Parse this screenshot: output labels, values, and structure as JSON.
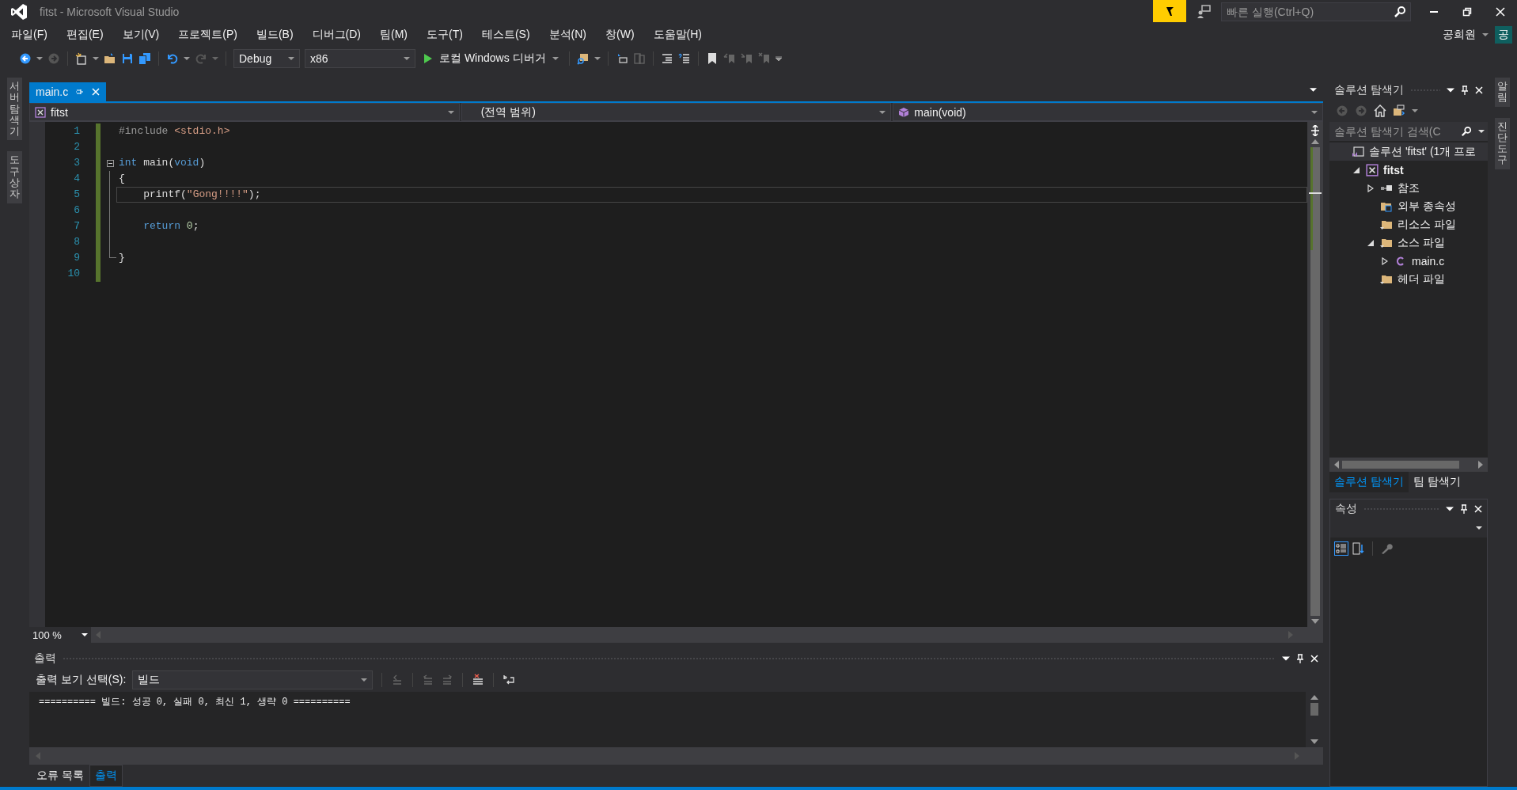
{
  "window": {
    "title": "fitst - Microsoft Visual Studio"
  },
  "title_bar": {
    "quick_launch_placeholder": "빠른 실행(Ctrl+Q)",
    "user": "공희원",
    "avatar": "공"
  },
  "menu": [
    "파일(F)",
    "편집(E)",
    "보기(V)",
    "프로젝트(P)",
    "빌드(B)",
    "디버그(D)",
    "팀(M)",
    "도구(T)",
    "테스트(S)",
    "분석(N)",
    "창(W)",
    "도움말(H)"
  ],
  "toolbar": {
    "configuration": "Debug",
    "platform": "x86",
    "run_label": "로컬 Windows 디버거"
  },
  "left_strip": [
    "서버 탐색기",
    "도구 상자"
  ],
  "right_strip": [
    "알림",
    "진단 도구"
  ],
  "document_tabs": [
    {
      "label": "main.c",
      "selected": true
    }
  ],
  "navigation_bar": {
    "project": "fitst",
    "scope": "(전역 범위)",
    "member": "main(void)"
  },
  "editor": {
    "zoom": "100 %",
    "lines": [
      {
        "number": "1",
        "collapsible": false,
        "in_block": false,
        "current": false,
        "tokens": [
          {
            "text": "#include ",
            "kind": "preprocessor"
          },
          {
            "text": "<stdio.h>",
            "kind": "string"
          }
        ]
      },
      {
        "number": "2",
        "collapsible": false,
        "in_block": false,
        "current": false
      },
      {
        "number": "3",
        "collapsible": true,
        "in_block": false,
        "current": false,
        "tokens": [
          {
            "text": "int",
            "kind": "keyword"
          },
          {
            "text": " main(",
            "kind": "plain"
          },
          {
            "text": "void",
            "kind": "keyword"
          },
          {
            "text": ")",
            "kind": "plain"
          }
        ]
      },
      {
        "number": "4",
        "collapsible": false,
        "in_block": true,
        "current": false,
        "tokens": [
          {
            "text": "{",
            "kind": "plain"
          }
        ]
      },
      {
        "number": "5",
        "collapsible": false,
        "in_block": true,
        "current": true,
        "tokens": [
          {
            "text": "    printf(",
            "kind": "plain"
          },
          {
            "text": "\"Gong!!!!\"",
            "kind": "string"
          },
          {
            "text": ");",
            "kind": "plain"
          }
        ]
      },
      {
        "number": "6",
        "collapsible": false,
        "in_block": true,
        "current": false
      },
      {
        "number": "7",
        "collapsible": false,
        "in_block": true,
        "current": false,
        "tokens": [
          {
            "text": "    return",
            "kind": "keyword"
          },
          {
            "text": " 0",
            "kind": "number"
          },
          {
            "text": ";",
            "kind": "plain"
          }
        ]
      },
      {
        "number": "8",
        "collapsible": false,
        "in_block": true,
        "current": false
      },
      {
        "number": "9",
        "collapsible": false,
        "in_block": true,
        "current": false,
        "tokens": [
          {
            "text": "}",
            "kind": "plain"
          }
        ]
      },
      {
        "number": "10",
        "collapsible": false,
        "in_block": false,
        "current": false
      }
    ]
  },
  "output": {
    "title": "출력",
    "source_label": "출력 보기 선택(S):",
    "source": "빌드",
    "text": "========== 빌드: 성공 0, 실패 0, 최신 1, 생략 0 =========="
  },
  "bottom_tabs": [
    {
      "label": "오류 목록",
      "selected": false
    },
    {
      "label": "출력",
      "selected": true
    }
  ],
  "solution_explorer": {
    "title": "솔루션 탐색기",
    "search_placeholder": "솔루션 탐색기 검색(C",
    "tree": [
      {
        "label": "솔루션 'fitst' (1개 프로",
        "kind": "solution",
        "selected": true,
        "children": [
          {
            "label": "fitst",
            "kind": "project",
            "selected": false,
            "expanded": true,
            "children": [
              {
                "label": "참조",
                "kind": "references",
                "selected": false,
                "expanded": false
              },
              {
                "label": "외부 종속성",
                "kind": "external",
                "selected": false
              },
              {
                "label": "리소스 파일",
                "kind": "folder",
                "selected": false
              },
              {
                "label": "소스 파일",
                "kind": "folder",
                "selected": false,
                "expanded": true,
                "children": [
                  {
                    "label": "main.c",
                    "kind": "cfile",
                    "selected": false,
                    "expanded": false
                  }
                ]
              },
              {
                "label": "헤더 파일",
                "kind": "folder",
                "selected": false
              }
            ]
          }
        ]
      }
    ]
  },
  "panel_tabs": [
    {
      "label": "솔루션 탐색기",
      "selected": true
    },
    {
      "label": "팀 탐색기",
      "selected": false
    }
  ],
  "properties": {
    "title": "속성"
  }
}
